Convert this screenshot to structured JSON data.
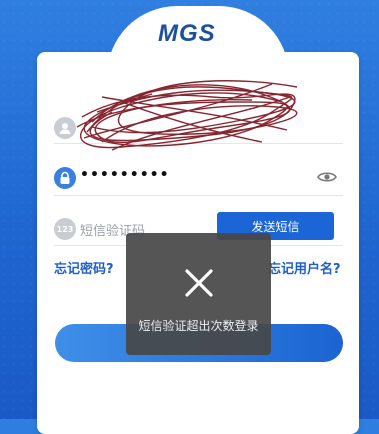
{
  "app": {
    "logo_text": "MGS"
  },
  "form": {
    "password_value": "•••••••••",
    "sms_placeholder": "短信验证码",
    "send_sms_label": "发送短信",
    "forgot_password_label": "忘记密码?",
    "forgot_username_label": "忘记用户名?"
  },
  "toast": {
    "message": "短信验证超出次数登录"
  },
  "icons": {
    "user": "user-icon",
    "lock": "lock-icon",
    "eye": "eye-icon",
    "sms": "sms-badge-icon",
    "toast": "close-x-icon"
  },
  "colors": {
    "primary": "#1b65d6",
    "link": "#1d5fc9",
    "background": "#2f7fe0"
  }
}
